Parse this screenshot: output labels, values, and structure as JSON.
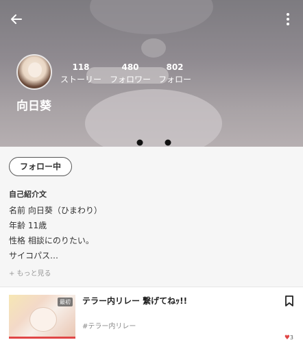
{
  "profile": {
    "name": "向日葵",
    "stats": [
      {
        "value": "118",
        "label": "ストーリー"
      },
      {
        "value": "480",
        "label": "フォロワー"
      },
      {
        "value": "802",
        "label": "フォロー"
      }
    ]
  },
  "actions": {
    "follow_label": "フォロー中"
  },
  "intro": {
    "title": "自己紹介文",
    "lines": [
      "名前 向日葵（ひまわり）",
      "年齢 11歳",
      "性格 相談にのりたい。",
      "サイコパス…"
    ],
    "more_label": "+ もっと見る"
  },
  "story": {
    "title": "テラー内リレー 繋げてねｯ!!",
    "tag": "#テラー内リレー",
    "badge": "最初",
    "likes": "3"
  },
  "colors": {
    "accent_red": "#e04646",
    "header_gray": "#8f8a90"
  },
  "icons": {
    "back": "arrow-left-icon",
    "menu": "more-vertical-icon",
    "bookmark": "bookmark-icon",
    "heart": "heart-icon"
  }
}
